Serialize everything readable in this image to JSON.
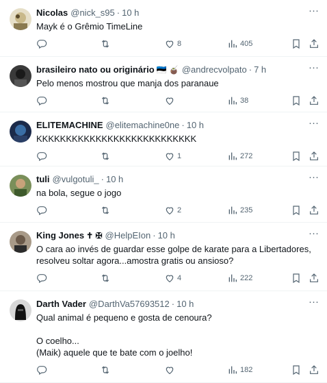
{
  "tweets": [
    {
      "name": "Nicolas",
      "name_extra": "",
      "handle": "@nick_s95",
      "time": "10 h",
      "lines": [
        "Mayk é o Grêmio TimeLine"
      ],
      "replies": "",
      "retweets": "",
      "likes": "8",
      "views": "405",
      "avatar_color": "#c9b98a"
    },
    {
      "name": "brasileiro nato ou originário",
      "name_extra": "🇪🇪 🧉",
      "handle": "@andrecvolpato",
      "time": "7 h",
      "lines": [
        "Pelo menos mostrou que manja dos paranaue"
      ],
      "replies": "",
      "retweets": "",
      "likes": "",
      "views": "38",
      "avatar_color": "#2d2d2d"
    },
    {
      "name": "ELITEMACHINE",
      "name_extra": "",
      "handle": "@elitemachine0ne",
      "time": "10 h",
      "lines": [
        "KKKKKKKKKKKKKKKKKKKKKKKKKKK"
      ],
      "replies": "",
      "retweets": "",
      "likes": "1",
      "views": "272",
      "avatar_color": "#1b2a4a"
    },
    {
      "name": "tuli",
      "name_extra": "",
      "handle": "@vulgotuli_",
      "time": "10 h",
      "lines": [
        "na bola, segue o jogo"
      ],
      "replies": "",
      "retweets": "",
      "likes": "2",
      "views": "235",
      "avatar_color": "#4f6b3a"
    },
    {
      "name": "King Jones",
      "name_extra": "✝ ✠",
      "handle": "@HelpEIon",
      "time": "10 h",
      "lines": [
        "O cara ao invés de guardar esse golpe de karate para a Libertadores,",
        "resolveu soltar agora...amostra gratis ou ansioso?"
      ],
      "replies": "",
      "retweets": "",
      "likes": "4",
      "views": "222",
      "avatar_color": "#6b5a4a"
    },
    {
      "name": "Darth Vader",
      "name_extra": "",
      "handle": "@DarthVa57693512",
      "time": "10 h",
      "lines": [
        "Qual animal é pequeno e gosta de cenoura?",
        "",
        "O coelho...",
        "(Maik) aquele que te bate com o joelho!"
      ],
      "replies": "",
      "retweets": "",
      "likes": "",
      "views": "182",
      "avatar_color": "#111111"
    }
  ],
  "more_label": "···",
  "icons": {
    "reply": "reply-icon",
    "retweet": "retweet-icon",
    "like": "like-icon",
    "views": "views-icon",
    "bookmark": "bookmark-icon",
    "share": "share-icon",
    "more": "more-icon"
  }
}
